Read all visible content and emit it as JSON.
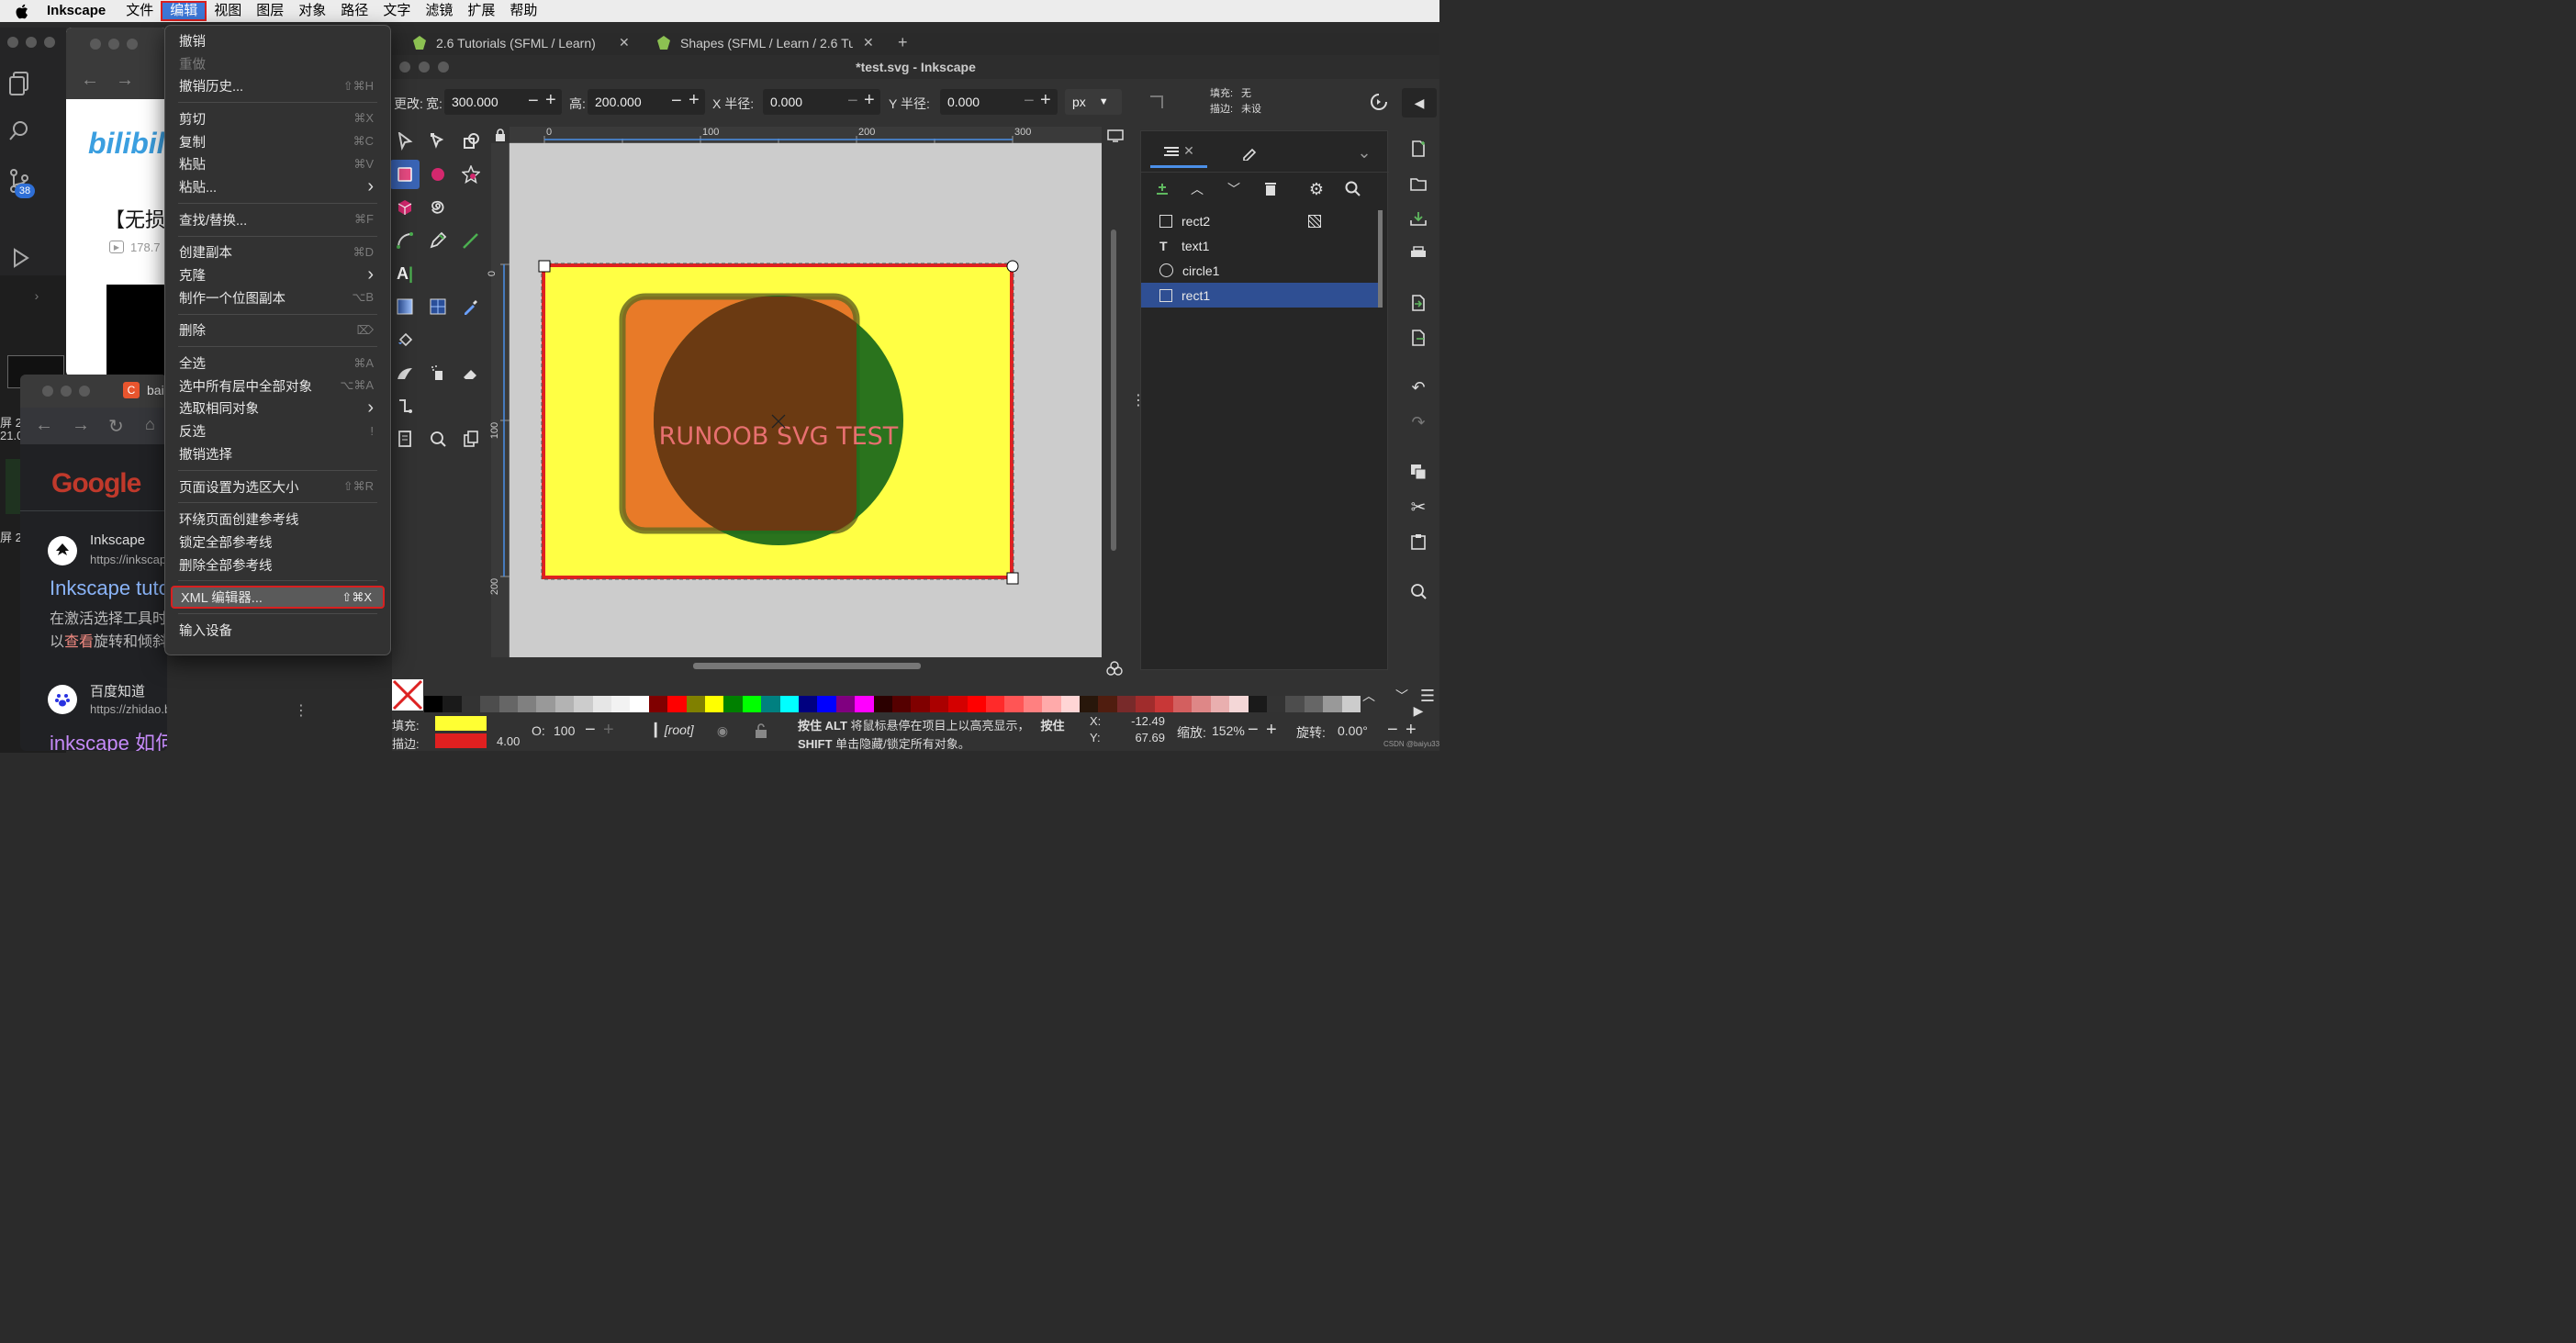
{
  "menubar": {
    "app": "Inkscape",
    "items": [
      "文件",
      "编辑",
      "视图",
      "图层",
      "对象",
      "路径",
      "文字",
      "滤镜",
      "扩展",
      "帮助"
    ]
  },
  "edit_menu": {
    "groups": [
      [
        {
          "label": "撤销",
          "shortcut": ""
        },
        {
          "label": "重做",
          "shortcut": "",
          "disabled": true
        },
        {
          "label": "撤销历史...",
          "shortcut": "⇧⌘H"
        }
      ],
      [
        {
          "label": "剪切",
          "shortcut": "⌘X"
        },
        {
          "label": "复制",
          "shortcut": "⌘C"
        },
        {
          "label": "粘贴",
          "shortcut": "⌘V"
        },
        {
          "label": "粘贴...",
          "shortcut": "›"
        }
      ],
      [
        {
          "label": "查找/替换...",
          "shortcut": "⌘F"
        }
      ],
      [
        {
          "label": "创建副本",
          "shortcut": "⌘D"
        },
        {
          "label": "克隆",
          "shortcut": "›"
        },
        {
          "label": "制作一个位图副本",
          "shortcut": "⌥B"
        }
      ],
      [
        {
          "label": "删除",
          "shortcut": "⌦"
        }
      ],
      [
        {
          "label": "全选",
          "shortcut": "⌘A"
        },
        {
          "label": "选中所有层中全部对象",
          "shortcut": "⌥⌘A"
        },
        {
          "label": "选取相同对象",
          "shortcut": "›"
        },
        {
          "label": "反选",
          "shortcut": "!"
        },
        {
          "label": "撤销选择",
          "shortcut": ""
        }
      ],
      [
        {
          "label": "页面设置为选区大小",
          "shortcut": "⇧⌘R"
        }
      ],
      [
        {
          "label": "环绕页面创建参考线",
          "shortcut": ""
        },
        {
          "label": "锁定全部参考线",
          "shortcut": ""
        },
        {
          "label": "删除全部参考线",
          "shortcut": ""
        }
      ],
      [
        {
          "label": "XML 编辑器...",
          "shortcut": "⇧⌘X",
          "highlight": true
        }
      ],
      [
        {
          "label": "输入设备",
          "shortcut": ""
        }
      ]
    ]
  },
  "background": {
    "bilibili_logo": "bilibili",
    "video_title": "【无损音",
    "view_count": "178.7",
    "side_text_1": "屏 2",
    "side_text_2": "21.0",
    "side_text_3": "屏 2",
    "vscode_badge": "38",
    "browser_tab": "bai",
    "google_logo": "Google",
    "result1_title": "Inkscape",
    "result1_url": "https://inkscap",
    "result1_heading": "Inkscape tuto",
    "result1_snippet_1": "在激活选择工具时",
    "result1_snippet_2a": "以",
    "result1_snippet_2b": "查看",
    "result1_snippet_2c": "旋转和倾斜",
    "result2_title": "百度知道",
    "result2_url": "https://zhidao.baidu.com › question",
    "result2_heading": "inkscape 如何查看代码"
  },
  "browser_tabs": [
    {
      "label": "2.6 Tutorials (SFML / Learn)"
    },
    {
      "label": "Shapes (SFML / Learn / 2.6 Tu"
    }
  ],
  "window_title": "*test.svg - Inkscape",
  "toolbar": {
    "change_label": "更改:",
    "width_label": "宽:",
    "width_value": "300.000",
    "height_label": "高:",
    "height_value": "200.000",
    "rx_label": "X 半径:",
    "rx_value": "0.000",
    "ry_label": "Y 半径:",
    "ry_value": "0.000",
    "unit": "px",
    "fill_label": "填充:",
    "fill_value": "无",
    "stroke_label": "描边:",
    "stroke_value": "未设"
  },
  "ruler": {
    "h_ticks": [
      "0",
      "100",
      "200",
      "300"
    ],
    "v_ticks": [
      "0",
      "100",
      "200"
    ]
  },
  "canvas": {
    "svg_text": "RUNOOB SVG TEST",
    "colors": {
      "page": "#ffff44",
      "border": "#e02020",
      "rect": "#e87a28",
      "circle": "#1f6b1b",
      "desk": "#cccccc"
    }
  },
  "layers": {
    "items": [
      {
        "name": "rect2",
        "icon": "square-icon",
        "selected": false
      },
      {
        "name": "text1",
        "icon": "text-icon",
        "selected": false
      },
      {
        "name": "circle1",
        "icon": "circle-icon",
        "selected": false
      },
      {
        "name": "rect1",
        "icon": "square-icon",
        "selected": true
      }
    ]
  },
  "palette": [
    "#000000",
    "#1a1a1a",
    "#333333",
    "#4d4d4d",
    "#666666",
    "#808080",
    "#999999",
    "#b3b3b3",
    "#cccccc",
    "#e6e6e6",
    "#f2f2f2",
    "#ffffff",
    "#800000",
    "#ff0000",
    "#808000",
    "#ffff00",
    "#008000",
    "#00ff00",
    "#008080",
    "#00ffff",
    "#000080",
    "#0000ff",
    "#800080",
    "#ff00ff",
    "#2b0000",
    "#550000",
    "#800000",
    "#aa0000",
    "#d40000",
    "#ff0000",
    "#ff2a2a",
    "#ff5555",
    "#ff8080",
    "#ffaaaa",
    "#ffd5d5",
    "#28170b",
    "#501d0f",
    "#782a2a",
    "#a02c2c",
    "#c83737",
    "#d35f5f",
    "#de8787",
    "#e9afaf",
    "#f4d7d7",
    "#1a1a1a",
    "#333333",
    "#4d4d4d",
    "#666666",
    "#999999",
    "#cccccc"
  ],
  "statusbar": {
    "fill_label": "填充:",
    "stroke_label": "描边:",
    "fill_color": "#ffff33",
    "stroke_color": "#e02020",
    "stroke_width": "4.00",
    "opacity_label": "O:",
    "opacity_value": "100",
    "layer": "[root]",
    "message_line1_a": "按住 ALT",
    "message_line1_b": " 将鼠标悬停在项目上以高亮显示，",
    "message_line1_c": "按住",
    "message_line2_a": "SHIFT",
    "message_line2_b": " 单击隐藏/锁定所有对象。",
    "x_label": "X:",
    "x_value": "-12.49",
    "y_label": "Y:",
    "y_value": "67.69",
    "zoom_label": "缩放:",
    "zoom_value": "152%",
    "rotate_label": "旋转:",
    "rotate_value": "0.00°",
    "watermark": "CSDN @baiyu33"
  }
}
